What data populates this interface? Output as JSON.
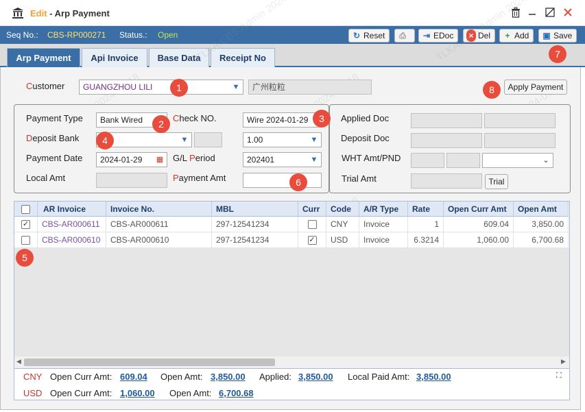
{
  "window": {
    "title_prefix": "Edit",
    "title_sep": " - ",
    "title": "Arp Payment"
  },
  "info": {
    "seq_label": "Seq No.:",
    "seq_value": "CBS-RP000271",
    "status_label": "Status.:",
    "status_value": "Open"
  },
  "toolbar": {
    "reset": "Reset",
    "edoc": "EDoc",
    "del": "Del",
    "add": "Add",
    "save": "Save"
  },
  "tabs": [
    "Arp Payment",
    "Api Invoice",
    "Base Data",
    "Receipt No"
  ],
  "form": {
    "customer_label_first": "C",
    "customer_label_rest": "ustomer",
    "customer_value": "GUANGZHOU LILI",
    "customer_local_name": "广州粒粒",
    "apply_payment": "Apply Payment",
    "payment_type_label": "Payment Type",
    "payment_type_value": "Bank Wired",
    "check_no_label_first": "C",
    "check_no_label_rest": "heck NO.",
    "check_no_value": "Wire 2024-01-29",
    "deposit_bank_label_first": "D",
    "deposit_bank_label_rest": "eposit Bank",
    "deposit_bank_value": "",
    "rate_value": "1.00",
    "payment_date_label": "Payment Date",
    "payment_date_value": "2024-01-29",
    "gl_period_label_pre": "G/L ",
    "gl_period_label_first": "P",
    "gl_period_label_rest": "eriod",
    "gl_period_value": "202401",
    "local_amt_label": "Local Amt",
    "local_amt_value": "",
    "payment_amt_label_first": "P",
    "payment_amt_label_rest": "ayment Amt",
    "payment_amt_value": "",
    "applied_doc_label": "Applied Doc",
    "deposit_doc_label": "Deposit Doc",
    "wht_label": "WHT Amt/PND",
    "trial_amt_label": "Trial Amt",
    "trial_button": "Trial"
  },
  "grid": {
    "columns": [
      "AR Invoice",
      "Invoice No.",
      "MBL",
      "Curr",
      "Code",
      "A/R Type",
      "Rate",
      "Open Curr Amt",
      "Open Amt"
    ],
    "rows": [
      {
        "checked": true,
        "ar_invoice": "CBS-AR000611",
        "invoice_no": "CBS-AR000611",
        "mbl": "297-12541234",
        "curr_checked": false,
        "code": "CNY",
        "ar_type": "Invoice",
        "rate": "1",
        "open_curr_amt": "609.04",
        "open_amt": "3,850.00"
      },
      {
        "checked": false,
        "ar_invoice": "CBS-AR000610",
        "invoice_no": "CBS-AR000610",
        "mbl": "297-12541234",
        "curr_checked": true,
        "code": "USD",
        "ar_type": "Invoice",
        "rate": "6.3214",
        "open_curr_amt": "1,060.00",
        "open_amt": "6,700.68"
      }
    ]
  },
  "footer": {
    "line1": {
      "curr": "CNY",
      "open_curr_label": "Open Curr Amt:",
      "open_curr_value": "609.04",
      "open_label": "Open Amt:",
      "open_value": "3,850.00",
      "applied_label": "Applied:",
      "applied_value": "3,850.00",
      "local_paid_label": "Local Paid Amt:",
      "local_paid_value": "3,850.00"
    },
    "line2": {
      "curr": "USD",
      "open_curr_label": "Open Curr Amt:",
      "open_curr_value": "1,060.00",
      "open_label": "Open Amt:",
      "open_value": "6,700.68"
    }
  },
  "badges": [
    "1",
    "2",
    "3",
    "4",
    "5",
    "6",
    "7",
    "8"
  ],
  "watermark": "TLKA.CBS.Admin 2024-07-18",
  "icons": {
    "app": "bank-icon",
    "delete": "trash-icon",
    "minimize": "minimize-icon",
    "maximize": "maximize-icon",
    "close": "close-icon"
  },
  "colors": {
    "accent": "#3a6ea5",
    "edit": "#f0a030",
    "status_open": "#c5e84a",
    "seq": "#ffe36b",
    "badge": "#e74c3c",
    "link": "#7a4fa3"
  }
}
